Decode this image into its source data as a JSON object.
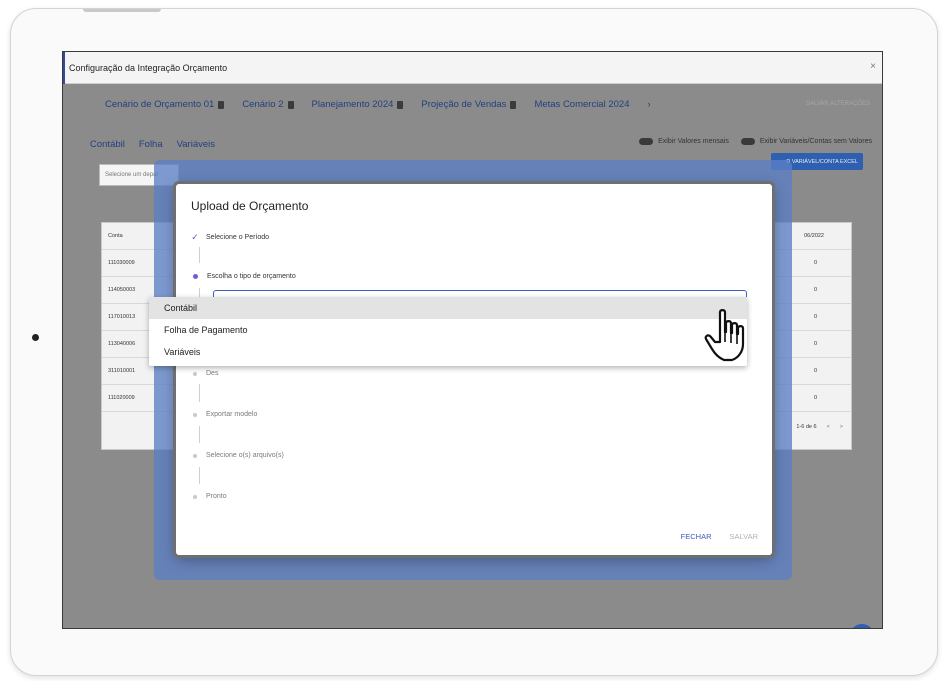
{
  "window": {
    "title": "Configuração da Integração Orçamento",
    "close_icon": "×",
    "save_changes": "SALVAR ALTERAÇÕES"
  },
  "scenario_tabs": [
    {
      "label": "Cenário de Orçamento 01"
    },
    {
      "label": "Cenário 2"
    },
    {
      "label": "Planejamento 2024"
    },
    {
      "label": "Projeção de Vendas"
    },
    {
      "label": "Metas Comercial 2024"
    }
  ],
  "scenario_tabs_more": "›",
  "sub_tabs": [
    "Contábil",
    "Folha",
    "Variáveis"
  ],
  "toggles": {
    "monthly_values": "Exibir Valores mensais",
    "variables_without_values": "Exibir Variáveis/Contas sem Valores"
  },
  "excel_button": "D VARIÁVEL/CONTA EXCEL",
  "department_select_placeholder": "Selecione um depar",
  "table": {
    "col_account": "Conta",
    "col_period": "06/2022",
    "rows": [
      {
        "account": "111030009",
        "value": "0"
      },
      {
        "account": "114050003",
        "value": "0"
      },
      {
        "account": "117010013",
        "value": "0"
      },
      {
        "account": "113040006",
        "value": "0"
      },
      {
        "account": "311010001",
        "value": "0"
      },
      {
        "account": "111020009",
        "value": "0"
      }
    ],
    "pagination": "1-6 de 6",
    "prev": "<",
    "next": ">"
  },
  "dialog": {
    "title": "Upload de Orçamento",
    "steps": [
      {
        "label": "Selecione o Período"
      },
      {
        "label": "Escolha o tipo de orçamento"
      },
      {
        "label": "Des"
      },
      {
        "label": "Exportar modelo"
      },
      {
        "label": "Selecione o(s) arquivo(s)"
      },
      {
        "label": "Pronto"
      }
    ],
    "select_value": "",
    "options": [
      "Contábil",
      "Folha de Pagamento",
      "Variáveis"
    ],
    "close_button": "FECHAR",
    "save_button": "SALVAR"
  },
  "colors": {
    "accent": "#3d5ec2",
    "tab_text": "#23407e",
    "step_active": "#6b5fd6"
  }
}
